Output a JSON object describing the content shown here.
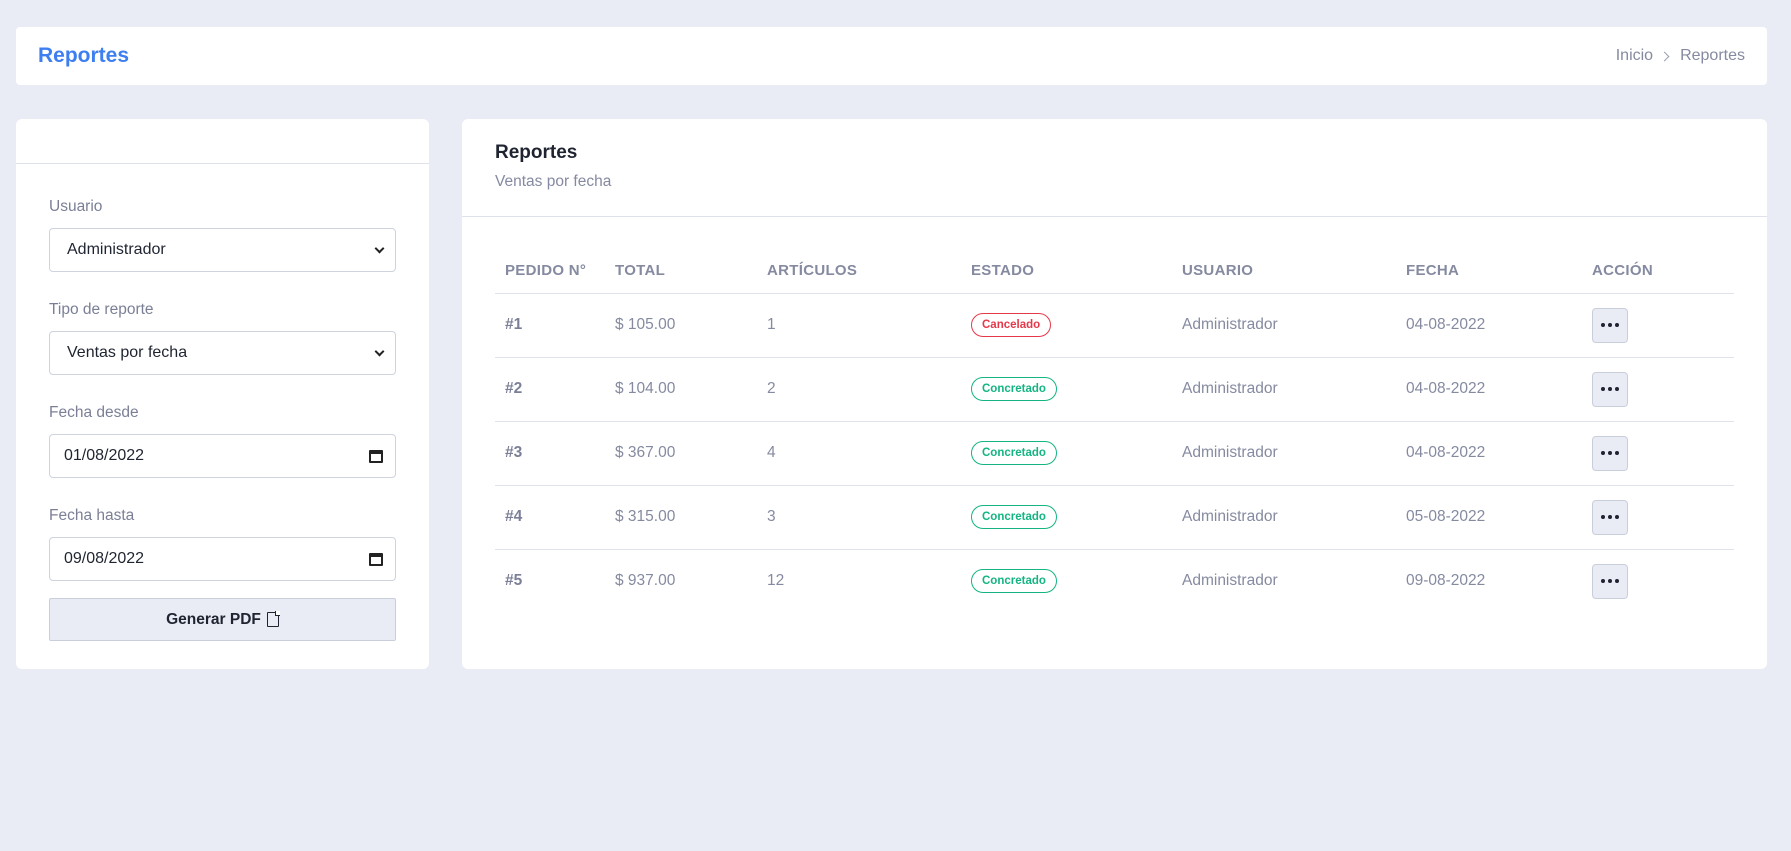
{
  "header": {
    "title": "Reportes",
    "breadcrumb": [
      "Inicio",
      "Reportes"
    ]
  },
  "filters": {
    "usuario_label": "Usuario",
    "usuario_value": "Administrador",
    "tipo_label": "Tipo de reporte",
    "tipo_value": "Ventas por fecha",
    "desde_label": "Fecha desde",
    "desde_value": "01/08/2022",
    "hasta_label": "Fecha hasta",
    "hasta_value": "09/08/2022",
    "generate_label": "Generar PDF"
  },
  "report": {
    "title": "Reportes",
    "subtitle": "Ventas por fecha",
    "columns": [
      "PEDIDO N°",
      "TOTAL",
      "ARTÍCULOS",
      "ESTADO",
      "USUARIO",
      "FECHA",
      "ACCIÓN"
    ],
    "rows": [
      {
        "id": "#1",
        "total": "$ 105.00",
        "items": "1",
        "status": "Cancelado",
        "user": "Administrador",
        "date": "04-08-2022"
      },
      {
        "id": "#2",
        "total": "$ 104.00",
        "items": "2",
        "status": "Concretado",
        "user": "Administrador",
        "date": "04-08-2022"
      },
      {
        "id": "#3",
        "total": "$ 367.00",
        "items": "4",
        "status": "Concretado",
        "user": "Administrador",
        "date": "04-08-2022"
      },
      {
        "id": "#4",
        "total": "$ 315.00",
        "items": "3",
        "status": "Concretado",
        "user": "Administrador",
        "date": "05-08-2022"
      },
      {
        "id": "#5",
        "total": "$ 937.00",
        "items": "12",
        "status": "Concretado",
        "user": "Administrador",
        "date": "09-08-2022"
      }
    ]
  },
  "colors": {
    "accent": "#3d7ef0",
    "cancelled": "#e5394a",
    "completed": "#14b582",
    "background": "#e9ecf4"
  }
}
